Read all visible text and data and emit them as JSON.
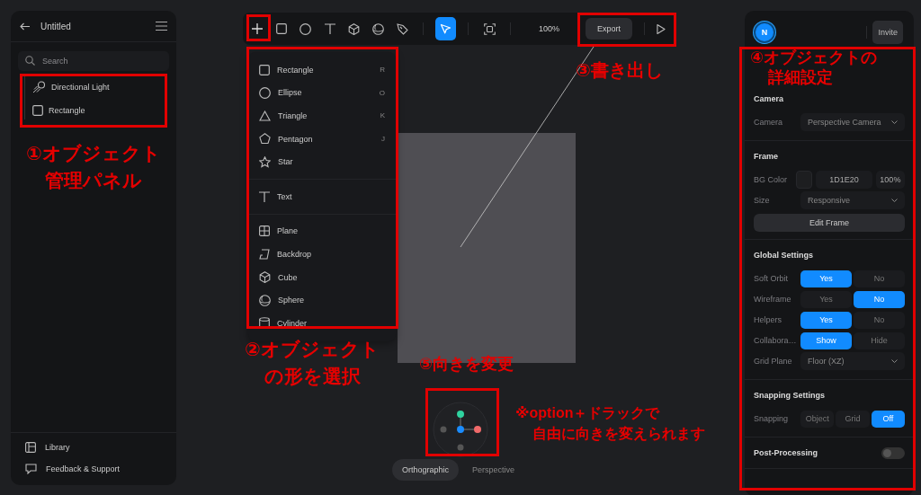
{
  "left_panel": {
    "title": "Untitled",
    "search": {
      "placeholder": "Search"
    },
    "layers": [
      {
        "name": "Directional Light",
        "kind": "light"
      },
      {
        "name": "Rectangle",
        "kind": "rectangle"
      }
    ],
    "footer": [
      {
        "label": "Library",
        "kind": "library"
      },
      {
        "label": "Feedback & Support",
        "kind": "feedback"
      }
    ]
  },
  "toolbar": {
    "tools": [
      {
        "kind": "add",
        "selected": false
      },
      {
        "kind": "rectangle",
        "selected": false
      },
      {
        "kind": "ellipse",
        "selected": false
      },
      {
        "kind": "text",
        "selected": false
      },
      {
        "kind": "cube",
        "selected": false
      },
      {
        "kind": "sphere",
        "selected": false
      },
      {
        "kind": "pen",
        "selected": false
      },
      {
        "kind": "pointer",
        "selected": true
      },
      {
        "kind": "frame",
        "selected": false
      }
    ],
    "zoom": "100%",
    "export": "Export"
  },
  "shape_menu": [
    [
      {
        "label": "Rectangle",
        "shortcut": "R",
        "kind": "rectangle"
      },
      {
        "label": "Ellipse",
        "shortcut": "O",
        "kind": "ellipse"
      },
      {
        "label": "Triangle",
        "shortcut": "K",
        "kind": "triangle"
      },
      {
        "label": "Pentagon",
        "shortcut": "J",
        "kind": "pentagon"
      },
      {
        "label": "Star",
        "kind": "star"
      }
    ],
    [
      {
        "label": "Text",
        "kind": "text"
      }
    ],
    [
      {
        "label": "Plane",
        "kind": "plane"
      },
      {
        "label": "Backdrop",
        "kind": "backdrop"
      },
      {
        "label": "Cube",
        "kind": "cube"
      },
      {
        "label": "Sphere",
        "kind": "sphere"
      },
      {
        "label": "Cylinder",
        "kind": "cylinder"
      }
    ]
  ],
  "view_modes": [
    {
      "label": "Orthographic",
      "selected": true
    },
    {
      "label": "Perspective",
      "selected": false
    }
  ],
  "right_panel": {
    "avatar": "N",
    "invite": "Invite",
    "sections": [
      {
        "title": "Camera",
        "rows": [
          {
            "kind": "dropdown",
            "label": "Camera",
            "value": "Perspective Camera"
          }
        ]
      },
      {
        "title": "Frame",
        "rows": [
          {
            "kind": "color",
            "label": "BG Color",
            "value": "1D1E20",
            "opacity": "100%"
          },
          {
            "kind": "dropdown",
            "label": "Size",
            "value": "Responsive"
          },
          {
            "kind": "button",
            "value": "Edit Frame"
          }
        ]
      },
      {
        "title": "Global Settings",
        "rows": [
          {
            "kind": "segments",
            "label": "Soft Orbit",
            "options": [
              {
                "label": "Yes",
                "selected": true
              },
              {
                "label": "No",
                "selected": false
              }
            ]
          },
          {
            "kind": "segments",
            "label": "Wireframe",
            "options": [
              {
                "label": "Yes",
                "selected": false
              },
              {
                "label": "No",
                "selected": true
              }
            ]
          },
          {
            "kind": "segments",
            "label": "Helpers",
            "options": [
              {
                "label": "Yes",
                "selected": true
              },
              {
                "label": "No",
                "selected": false
              }
            ]
          },
          {
            "kind": "segments",
            "label": "Collabora…",
            "options": [
              {
                "label": "Show",
                "selected": true
              },
              {
                "label": "Hide",
                "selected": false
              }
            ]
          },
          {
            "kind": "dropdown",
            "label": "Grid Plane",
            "value": "Floor (XZ)"
          }
        ]
      },
      {
        "title": "Snapping Settings",
        "rows": [
          {
            "kind": "segments",
            "label": "Snapping",
            "options": [
              {
                "label": "Object",
                "selected": false
              },
              {
                "label": "Grid",
                "selected": false
              },
              {
                "label": "Off",
                "selected": true
              }
            ]
          }
        ]
      },
      {
        "title": "Post-Processing",
        "toggle": {
          "on": false
        }
      }
    ]
  },
  "annotations": [
    {
      "lines": [
        "①オブジェクト",
        "管理パネル"
      ]
    },
    {
      "lines": [
        "②オブジェクト",
        "の形を選択"
      ]
    },
    {
      "lines": [
        "③書き出し"
      ]
    },
    {
      "lines": [
        "④オブジェクトの",
        "詳細設定"
      ]
    },
    {
      "lines": [
        "⑤向きを変更"
      ]
    },
    {
      "lines": [
        "※option＋ドラックで",
        "自由に向きを変えられます"
      ]
    }
  ]
}
